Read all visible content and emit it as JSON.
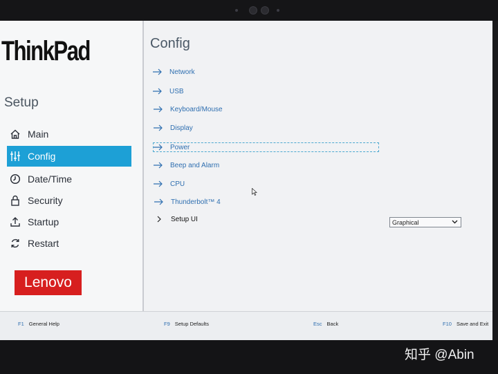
{
  "brand": {
    "thinkpad": "ThinkPad",
    "lenovo": "Lenovo",
    "lenovo_color": "#d71f1f"
  },
  "sidebar": {
    "title": "Setup",
    "accent": "#1da0d6",
    "items": [
      {
        "label": "Main",
        "icon": "home-icon"
      },
      {
        "label": "Config",
        "icon": "sliders-icon",
        "active": true
      },
      {
        "label": "Date/Time",
        "icon": "clock-icon"
      },
      {
        "label": "Security",
        "icon": "lock-icon"
      },
      {
        "label": "Startup",
        "icon": "upload-icon"
      },
      {
        "label": "Restart",
        "icon": "restart-icon"
      }
    ]
  },
  "main": {
    "title": "Config",
    "items": [
      {
        "label": "Network",
        "icon": "arrow-right-icon"
      },
      {
        "label": "USB",
        "icon": "arrow-right-icon"
      },
      {
        "label": "Keyboard/Mouse",
        "icon": "arrow-right-icon"
      },
      {
        "label": "Display",
        "icon": "arrow-right-icon"
      },
      {
        "label": "Power",
        "icon": "arrow-right-icon",
        "focused": true
      },
      {
        "label": "Beep and Alarm",
        "icon": "arrow-right-icon"
      },
      {
        "label": "CPU",
        "icon": "arrow-right-icon"
      },
      {
        "label": "Thunderbolt™ 4",
        "icon": "arrow-right-icon"
      }
    ],
    "setup_ui": {
      "label": "Setup UI",
      "icon": "chevron-right-icon",
      "value": "Graphical"
    }
  },
  "footer": {
    "f1": {
      "key": "F1",
      "label": "General Help"
    },
    "f9": {
      "key": "F9",
      "label": "Setup Defaults"
    },
    "esc": {
      "key": "Esc",
      "label": "Back"
    },
    "f10": {
      "key": "F10",
      "label": "Save and Exit"
    }
  },
  "watermark": "知乎 @Abin"
}
